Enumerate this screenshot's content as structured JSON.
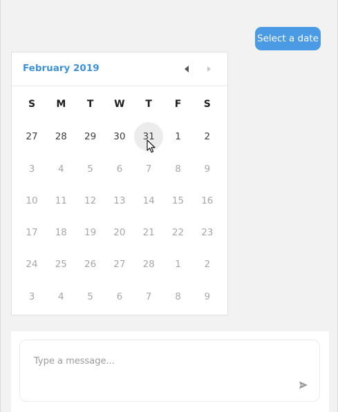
{
  "prompt_chip": {
    "label": "Select a date"
  },
  "calendar": {
    "month_title": "February 2019",
    "weekdays": [
      "S",
      "M",
      "T",
      "W",
      "T",
      "F",
      "S"
    ],
    "weeks": [
      [
        "27",
        "28",
        "29",
        "30",
        "31",
        "1",
        "2"
      ],
      [
        "3",
        "4",
        "5",
        "6",
        "7",
        "8",
        "9"
      ],
      [
        "10",
        "11",
        "12",
        "13",
        "14",
        "15",
        "16"
      ],
      [
        "17",
        "18",
        "19",
        "20",
        "21",
        "22",
        "23"
      ],
      [
        "24",
        "25",
        "26",
        "27",
        "28",
        "1",
        "2"
      ],
      [
        "3",
        "4",
        "5",
        "6",
        "7",
        "8",
        "9"
      ]
    ],
    "active_rows": [
      0
    ],
    "hovered": {
      "row": 0,
      "col": 4
    },
    "prev_icon": "caret-left-icon",
    "next_icon": "caret-right-icon"
  },
  "composer": {
    "placeholder": "Type a message...",
    "send_icon": "send-icon"
  },
  "colors": {
    "accent": "#4a9be3",
    "title": "#3c91d8",
    "muted_day": "#a6a6a6",
    "hover_bg": "#ececec"
  }
}
